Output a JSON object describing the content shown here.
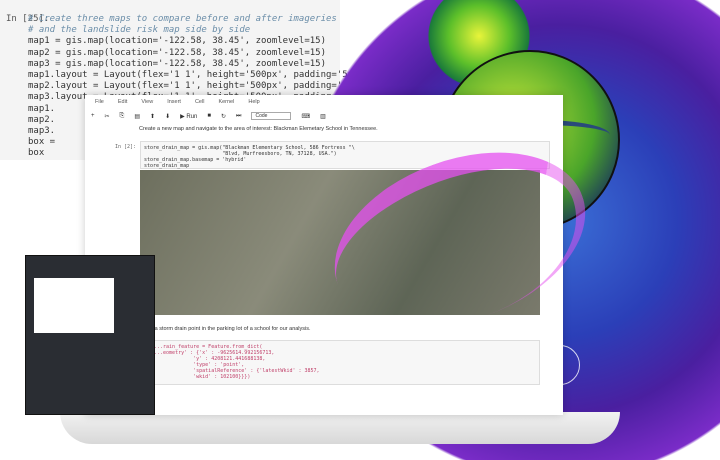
{
  "background_code": {
    "prompt": "In [25]:",
    "lines": [
      "# Create three maps to compare before and after imageries",
      "# and the landslide risk map side by side",
      "map1 = gis.map(location='-122.58, 38.45', zoomlevel=15)",
      "map2 = gis.map(location='-122.58, 38.45', zoomlevel=15)",
      "map3 = gis.map(location='-122.58, 38.45', zoomlevel=15)",
      "map1.layout = Layout(flex='1 1', height='500px', padding='5px')",
      "map2.layout = Layout(flex='1 1', height='500px', padding='5px')",
      "map3.layout = Layout(flex='1 1', height='500px', padding='5px')",
      "map1.",
      "map2.",
      "map3.",
      "box =",
      "box"
    ]
  },
  "notebook": {
    "menu": [
      "File",
      "Edit",
      "View",
      "Insert",
      "Cell",
      "Kernel",
      "Help"
    ],
    "toolbar": {
      "run": "Run",
      "cell_type": "Code"
    },
    "markdown1": "Create a new map and navigate to the area of interest: Blackman Elemetary School in Tennessee.",
    "cell1_prompt": "In [2]:",
    "cell1": "store_drain_map = gis.map(\"Blackman Elementary School, 586 Fortress \"\\\n                          \"Blvd, Murfreesboro, TN, 37128, USA.\")\nstore_drain_map.basemap = 'hybrid'\nstore_drain_map",
    "markdown2": "...ck a storm drain point in the parking lot of a school for our analysis.",
    "cell2": "...rain_feature = Feature.from_dict(\n...eometry' : {'x' : -9625614.992156713,\n             'y' : 4208121.441688138,\n             'type' : 'point',\n             'spatialReference' : {'latestWkid' : 3857,\n             'wkid' : 102100}}})"
  }
}
